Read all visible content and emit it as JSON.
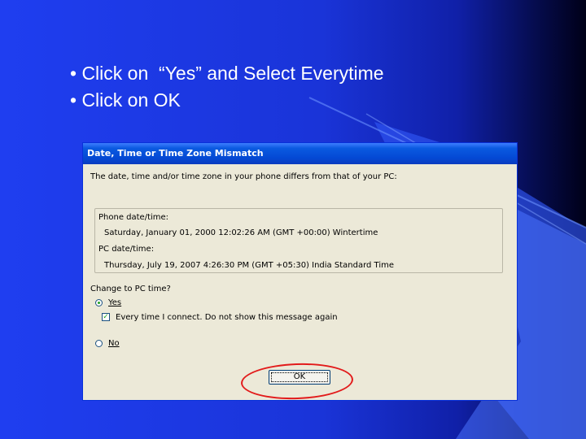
{
  "slide": {
    "bullets": [
      "• Click on  “Yes” and Select Everytime",
      "• Click on OK"
    ]
  },
  "dialog": {
    "title": "Date, Time or Time Zone Mismatch",
    "intro": "The date, time and/or time zone in your phone differs from that of your PC:",
    "phone_label": "Phone date/time:",
    "phone_value": "Saturday, January 01, 2000 12:02:26 AM (GMT +00:00) Wintertime",
    "pc_label": "PC date/time:",
    "pc_value": "Thursday, July 19, 2007 4:26:30 PM (GMT +05:30) India Standard Time",
    "question": "Change to PC time?",
    "yes_label": "Yes",
    "yes_selected": true,
    "every_time_label": "Every time I connect. Do not show this message again",
    "every_time_checked": true,
    "no_label": "No",
    "ok_label": "OK"
  },
  "colors": {
    "highlight_ring": "#e21b1b",
    "titlebar": "#0449d4"
  }
}
